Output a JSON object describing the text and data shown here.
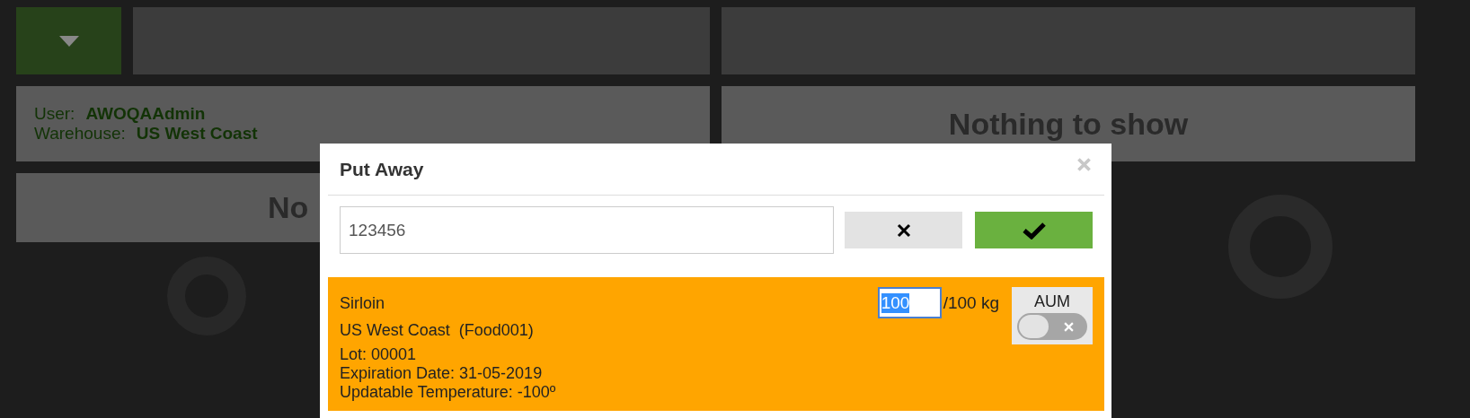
{
  "user_panel": {
    "user_label": "User:",
    "user": "AWOQAAdmin",
    "warehouse_label": "Warehouse:",
    "warehouse": "US West Coast"
  },
  "right_panel": {
    "message": "Nothing to show"
  },
  "left_panel": {
    "message": "No"
  },
  "dialog": {
    "title": "Put Away",
    "scan_field": {
      "value": "123456"
    },
    "items": [
      {
        "name": "Sirloin",
        "location": "US West Coast  (Food001)",
        "details": [
          "Lot: 00001",
          "Expiration Date: 31-05-2019",
          "Updatable Temperature: -100º"
        ],
        "quantity": "100",
        "total": "/100 kg",
        "aum_label": "AUM",
        "aum_on": false
      }
    ]
  }
}
